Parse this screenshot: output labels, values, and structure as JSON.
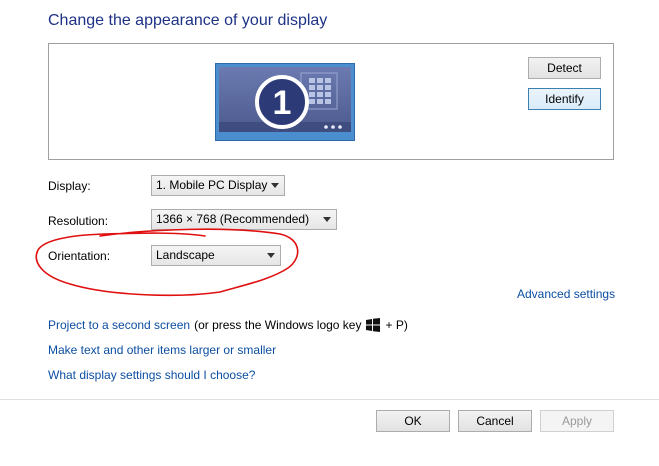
{
  "page": {
    "title": "Change the appearance of your display"
  },
  "monitor": {
    "number": "1",
    "icon": "monitor-icon",
    "colors": {
      "frame": "#4a8ed0",
      "screen": "#56669a",
      "badge": "#2d3a78"
    }
  },
  "buttons": {
    "detect": "Detect",
    "identify": "Identify",
    "ok": "OK",
    "cancel": "Cancel",
    "apply": "Apply"
  },
  "settings": {
    "display": {
      "label": "Display:",
      "value": "1. Mobile PC Display"
    },
    "resolution": {
      "label": "Resolution:",
      "value": "1366 × 768 (Recommended)"
    },
    "orientation": {
      "label": "Orientation:",
      "value": "Landscape"
    }
  },
  "links": {
    "advanced": "Advanced settings",
    "project": "Project to a second screen",
    "project_suffix_a": "(or press the Windows logo key",
    "project_suffix_b": "+ P)",
    "windows_key_icon": "windows-logo-icon",
    "text_size": "Make text and other items larger or smaller",
    "help": "What display settings should I choose?"
  },
  "annotation": {
    "color": "#e01010",
    "shape": "hand-drawn-ellipse"
  }
}
